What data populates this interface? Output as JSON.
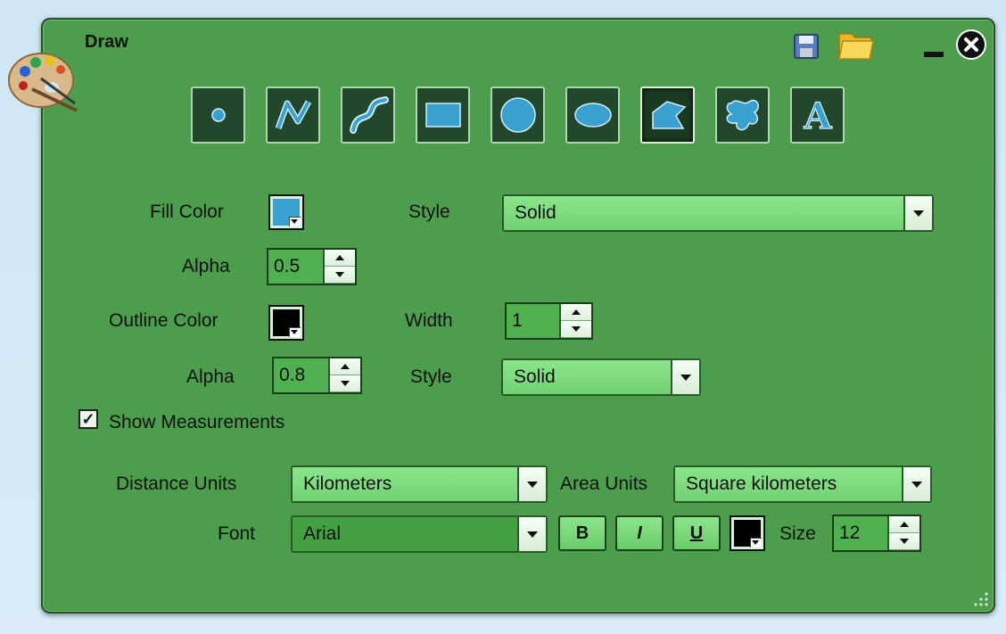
{
  "window": {
    "title": "Draw"
  },
  "header_icons": [
    "palette-icon",
    "save-icon",
    "folder-icon",
    "minimize-icon",
    "close-icon"
  ],
  "tools": [
    {
      "name": "point-tool",
      "icon": "point-icon"
    },
    {
      "name": "polyline-tool",
      "icon": "polyline-icon"
    },
    {
      "name": "freehand-line-tool",
      "icon": "freehand-line-icon"
    },
    {
      "name": "rectangle-tool",
      "icon": "rectangle-icon"
    },
    {
      "name": "circle-tool",
      "icon": "circle-icon"
    },
    {
      "name": "ellipse-tool",
      "icon": "ellipse-icon"
    },
    {
      "name": "polygon-tool",
      "icon": "polygon-icon",
      "selected": true
    },
    {
      "name": "freehand-polygon-tool",
      "icon": "freehand-polygon-icon"
    },
    {
      "name": "text-tool",
      "icon": "text-icon"
    }
  ],
  "fill": {
    "color_label": "Fill Color",
    "color": "#3aa0d0",
    "style_label": "Style",
    "style_value": "Solid",
    "alpha_label": "Alpha",
    "alpha_value": "0.5"
  },
  "outline": {
    "color_label": "Outline Color",
    "color": "#000000",
    "width_label": "Width",
    "width_value": "1",
    "alpha_label": "Alpha",
    "alpha_value": "0.8",
    "style_label": "Style",
    "style_value": "Solid"
  },
  "measurements": {
    "show_label": "Show Measurements",
    "checked": true,
    "check_glyph": "✓",
    "distance_label": "Distance Units",
    "distance_value": "Kilometers",
    "area_label": "Area Units",
    "area_value": "Square kilometers"
  },
  "font": {
    "label": "Font",
    "value": "Arial",
    "bold": "B",
    "italic": "I",
    "underline": "U",
    "color": "#000000",
    "size_label": "Size",
    "size_value": "12"
  },
  "colors": {
    "panel": "#4c9e4c",
    "tool_bg": "#23472a",
    "icon_blue": "#3aa0d0"
  }
}
